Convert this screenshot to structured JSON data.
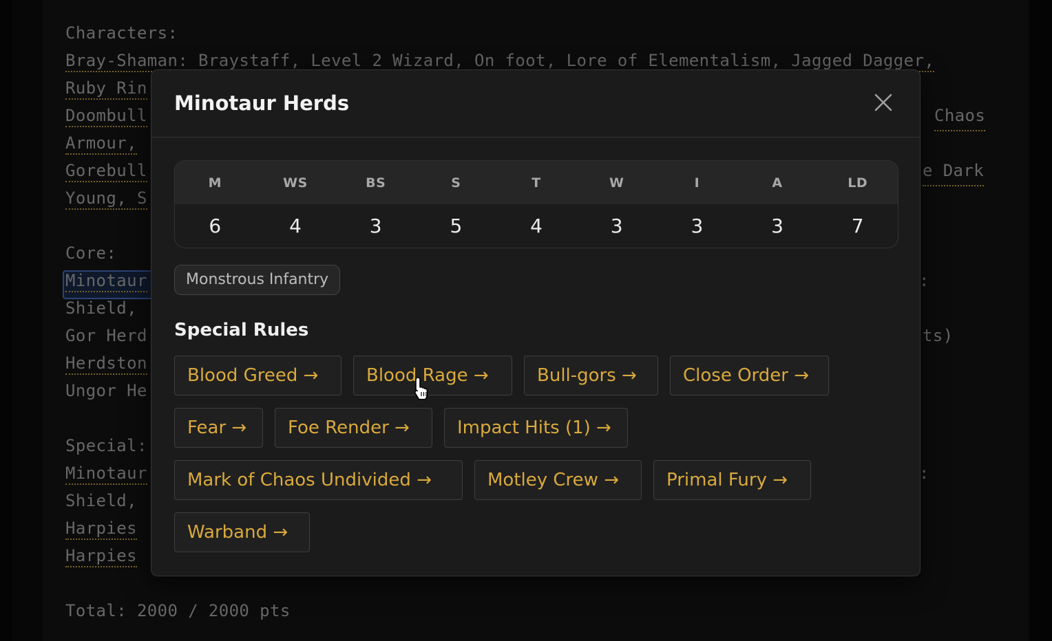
{
  "editor": {
    "lines": [
      {
        "text": "Characters:",
        "underlined": false
      },
      {
        "text": "Bray-Shaman: Braystaff, Level 2 Wizard, On foot, Lore of Elementalism, Jagged Dagger,",
        "underlined": true
      },
      {
        "text": "Ruby Rin",
        "underlined": true
      },
      {
        "text": "Doombull",
        "underlined": true,
        "tail": "Chaos"
      },
      {
        "text": "Armour,",
        "underlined": true
      },
      {
        "text": "Gorebull",
        "underlined": true,
        "tail": "e Dark"
      },
      {
        "text": "Young, S",
        "underlined": true
      },
      {
        "text": "",
        "underlined": false
      },
      {
        "text": "Core:",
        "underlined": false
      },
      {
        "text": "Minotaur",
        "underlined": true,
        "selected": true,
        "tail": ":"
      },
      {
        "text": "Shield,",
        "underlined": false
      },
      {
        "text": "Gor Herd",
        "underlined": false,
        "tail": "ts)"
      },
      {
        "text": "Herdston",
        "underlined": true
      },
      {
        "text": "Ungor He",
        "underlined": false
      },
      {
        "text": "",
        "underlined": false
      },
      {
        "text": "Special:",
        "underlined": false
      },
      {
        "text": "Minotaur",
        "underlined": true,
        "tail": ":"
      },
      {
        "text": "Shield,",
        "underlined": false
      },
      {
        "text": "Harpies",
        "underlined": true
      },
      {
        "text": "Harpies",
        "underlined": true
      },
      {
        "text": "",
        "underlined": false
      },
      {
        "text": "Total: 2000 / 2000 pts",
        "underlined": false
      }
    ]
  },
  "dialog": {
    "title": "Minotaur Herds",
    "close_icon": "close-icon",
    "stats": {
      "headers": [
        "M",
        "WS",
        "BS",
        "S",
        "T",
        "W",
        "I",
        "A",
        "LD"
      ],
      "values": [
        "6",
        "4",
        "3",
        "5",
        "4",
        "3",
        "3",
        "3",
        "7"
      ]
    },
    "troop_type": "Monstrous Infantry",
    "special_rules_title": "Special Rules",
    "special_rules": [
      "Blood Greed →",
      "Blood Rage →",
      "Bull-gors →",
      "Close Order →",
      "Fear →",
      "Foe Render →",
      "Impact Hits (1) →",
      "Mark of Chaos Undivided →",
      "Motley Crew →",
      "Primal Fury →",
      "Warband →"
    ]
  },
  "colors": {
    "accent": "#d9a93c",
    "dialog_bg": "#1b1b1b",
    "selection": "#3d5ea6"
  }
}
